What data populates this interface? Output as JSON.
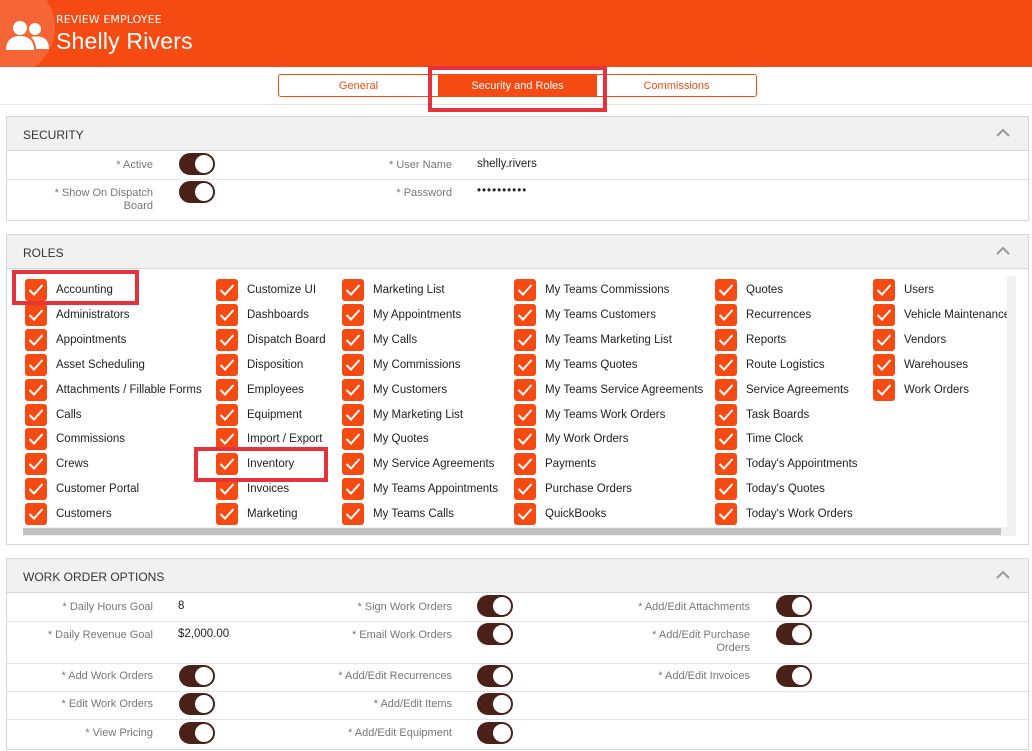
{
  "header": {
    "subtitle": "REVIEW EMPLOYEE",
    "title": "Shelly Rivers",
    "icon": "users-icon"
  },
  "tabs": [
    {
      "label": "General",
      "active": false
    },
    {
      "label": "Security and Roles",
      "active": true
    },
    {
      "label": "Commissions",
      "active": false
    }
  ],
  "security": {
    "title": "SECURITY",
    "active_label": "* Active",
    "active": true,
    "dispatch_label_1": "* Show On Dispatch",
    "dispatch_label_2": "Board",
    "dispatch": true,
    "username_label": "* User Name",
    "username": "shelly.rivers",
    "password_label": "* Password",
    "password": "••••••••••"
  },
  "roles": {
    "title": "ROLES",
    "columns": [
      [
        "Accounting",
        "Administrators",
        "Appointments",
        "Asset Scheduling",
        "Attachments / Fillable Forms",
        "Calls",
        "Commissions",
        "Crews",
        "Customer Portal",
        "Customers"
      ],
      [
        "Customize UI",
        "Dashboards",
        "Dispatch Board",
        "Disposition",
        "Employees",
        "Equipment",
        "Import / Export",
        "Inventory",
        "Invoices",
        "Marketing"
      ],
      [
        "Marketing List",
        "My Appointments",
        "My Calls",
        "My Commissions",
        "My Customers",
        "My Marketing List",
        "My Quotes",
        "My Service Agreements",
        "My Teams Appointments",
        "My Teams Calls"
      ],
      [
        "My Teams Commissions",
        "My Teams Customers",
        "My Teams Marketing List",
        "My Teams Quotes",
        "My Teams Service Agreements",
        "My Teams Work Orders",
        "My Work Orders",
        "Payments",
        "Purchase Orders",
        "QuickBooks"
      ],
      [
        "Quotes",
        "Recurrences",
        "Reports",
        "Route Logistics",
        "Service Agreements",
        "Task Boards",
        "Time Clock",
        "Today's Appointments",
        "Today's Quotes",
        "Today's Work Orders"
      ],
      [
        "Users",
        "Vehicle Maintenance",
        "Vendors",
        "Warehouses",
        "Work Orders"
      ]
    ]
  },
  "work_order_options": {
    "title": "WORK ORDER OPTIONS",
    "daily_hours_label": "* Daily Hours Goal",
    "daily_hours": "8",
    "daily_revenue_label": "* Daily Revenue Goal",
    "daily_revenue": "$2,000.00",
    "add_wo_label": "* Add Work Orders",
    "edit_wo_label": "* Edit Work Orders",
    "view_pricing_label": "* View Pricing",
    "sign_wo_label": "* Sign Work Orders",
    "email_wo_label": "* Email Work Orders",
    "recurrences_label": "* Add/Edit Recurrences",
    "items_label": "* Add/Edit Items",
    "equipment_label": "* Add/Edit Equipment",
    "attachments_label": "* Add/Edit Attachments",
    "purchase_orders_label_1": "* Add/Edit Purchase",
    "purchase_orders_label_2": "Orders",
    "invoices_label": "* Add/Edit Invoices"
  }
}
